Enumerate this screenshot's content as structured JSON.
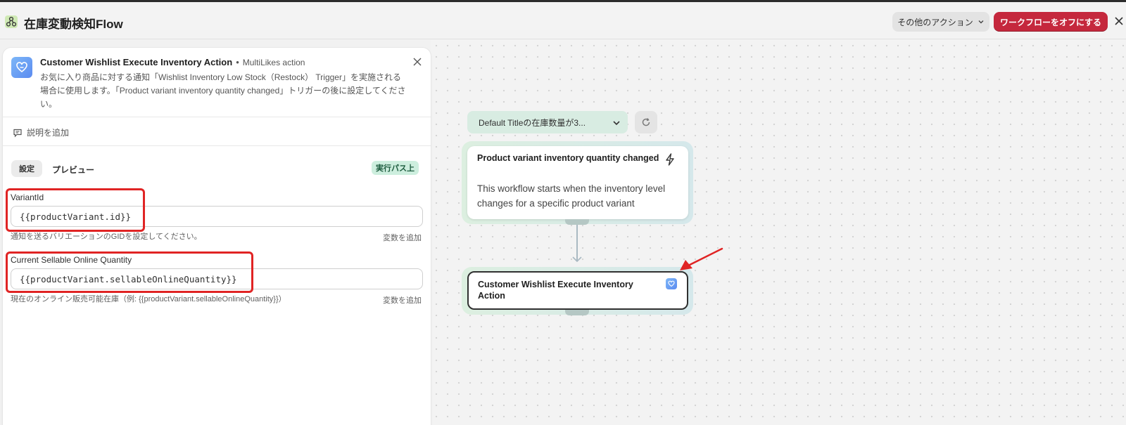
{
  "header": {
    "title": "在庫変動検知Flow",
    "more_actions_label": "その他のアクション",
    "turn_off_label": "ワークフローをオフにする"
  },
  "panel": {
    "title": "Customer Wishlist Execute Inventory Action",
    "separator": "•",
    "subtitle": "MultiLikes action",
    "description": "お気に入り商品に対する通知「Wishlist Inventory Low Stock（Restock） Trigger」を実施される場合に使用します。「Product variant inventory quantity changed」トリガーの後に設定してください。",
    "add_description_label": "説明を追加",
    "tabs": [
      {
        "label": "設定",
        "active": true
      },
      {
        "label": "プレビュー",
        "active": false
      }
    ],
    "path_badge": "実行パス上",
    "fields": [
      {
        "label": "VariantId",
        "value": "{{productVariant.id}}",
        "help": "通知を送るバリエーションのGIDを設定してください。",
        "add_variable_label": "変数を追加"
      },
      {
        "label": "Current Sellable Online Quantity",
        "value": "{{productVariant.sellableOnlineQuantity}}",
        "help": "現在のオンライン販売可能在庫（例: {{productVariant.sellableOnlineQuantity}}）",
        "add_variable_label": "変数を追加"
      }
    ]
  },
  "canvas": {
    "dropdown_label": "Default Titleの在庫数量が3...",
    "trigger_node": {
      "title": "Product variant inventory quantity changed",
      "description": "This workflow starts when the inventory level changes for a specific product variant",
      "icon": "lightning-icon"
    },
    "action_node": {
      "title": "Customer Wishlist Execute Inventory Action",
      "icon": "multilikes-icon"
    }
  },
  "colors": {
    "danger_button": "#c5283d",
    "highlight_box": "#e02424",
    "badge_bg": "#cdeede",
    "app_icon_bg": "#cfe9b4"
  }
}
